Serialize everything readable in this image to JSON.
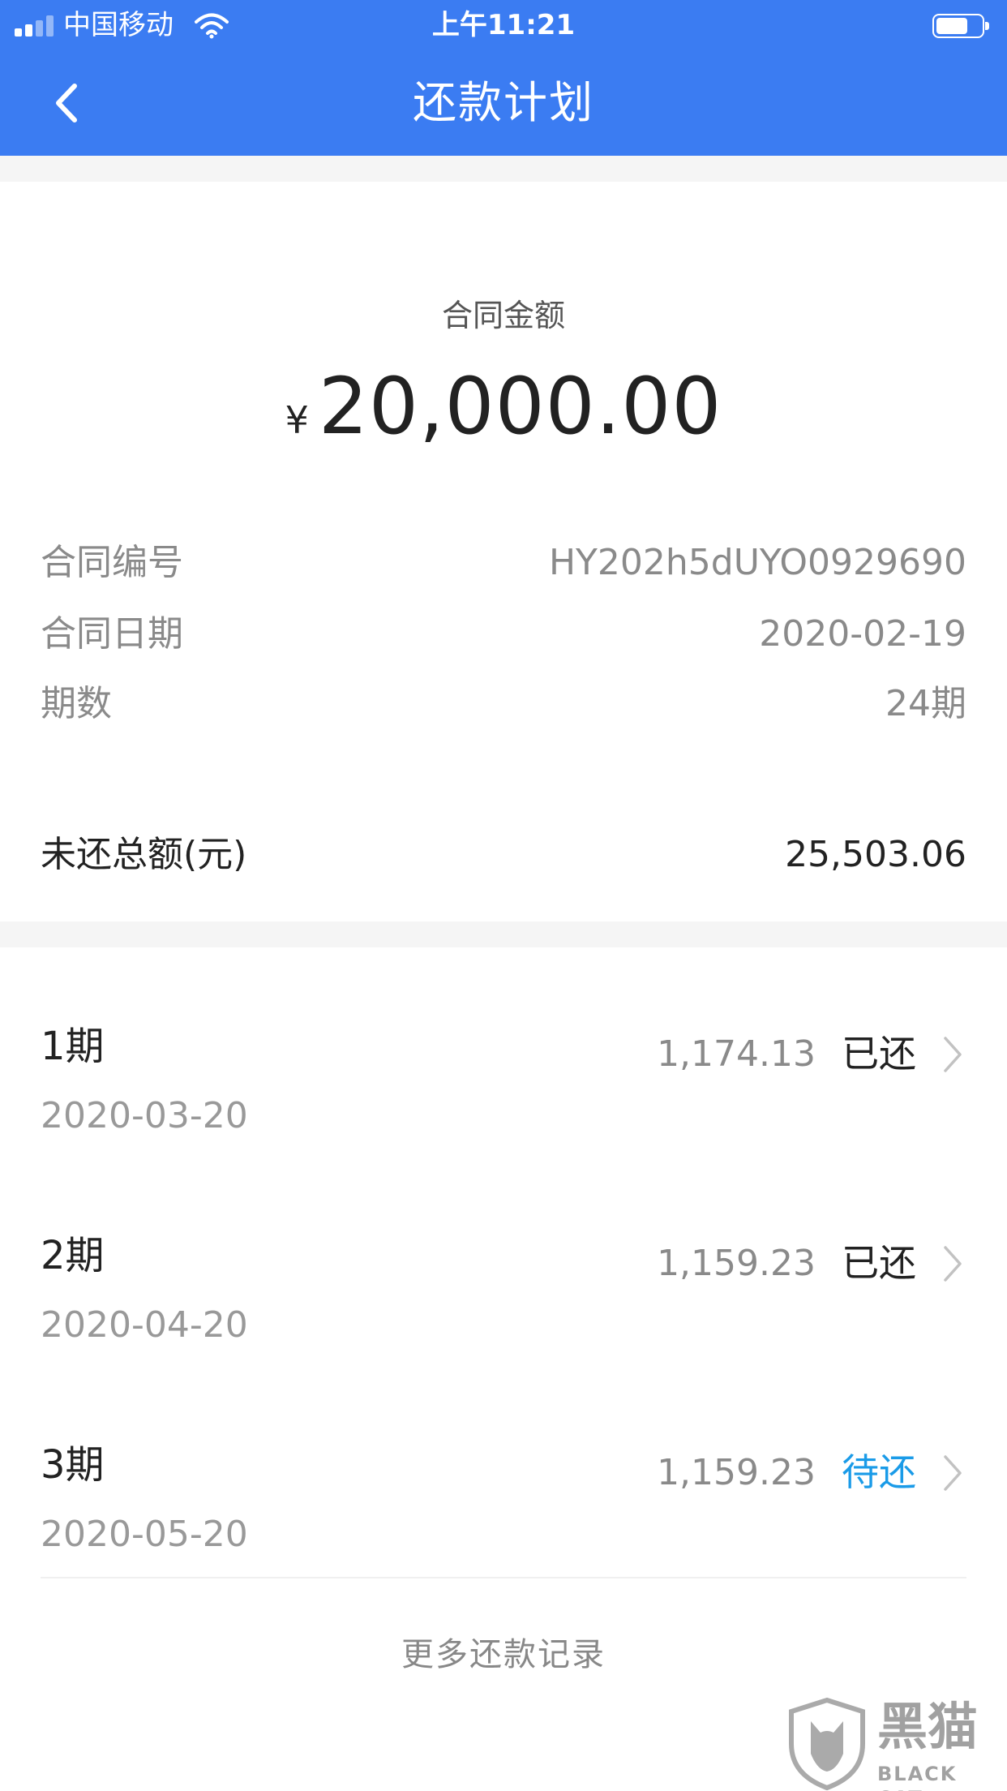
{
  "colors": {
    "brand": "#3b7cf2",
    "pending": "#1a9be8"
  },
  "status_bar": {
    "carrier": "中国移动",
    "time": "上午11:21"
  },
  "nav": {
    "title": "还款计划",
    "back_icon": "chevron-left-icon"
  },
  "summary": {
    "amount_label": "合同金额",
    "currency": "¥",
    "amount": "20,000.00",
    "contract_no_label": "合同编号",
    "contract_no": "HY202h5dUYO0929690",
    "contract_date_label": "合同日期",
    "contract_date": "2020-02-19",
    "periods_label": "期数",
    "periods": "24期",
    "outstanding_label": "未还总额(元)",
    "outstanding": "25,503.06"
  },
  "periods": [
    {
      "name": "1期",
      "date": "2020-03-20",
      "amount": "1,174.13",
      "status": "已还"
    },
    {
      "name": "2期",
      "date": "2020-04-20",
      "amount": "1,159.23",
      "status": "已还"
    },
    {
      "name": "3期",
      "date": "2020-05-20",
      "amount": "1,159.23",
      "status": "待还"
    }
  ],
  "more_records": "更多还款记录",
  "watermark": {
    "text": "黑猫",
    "sub": "BLACK CAT"
  }
}
